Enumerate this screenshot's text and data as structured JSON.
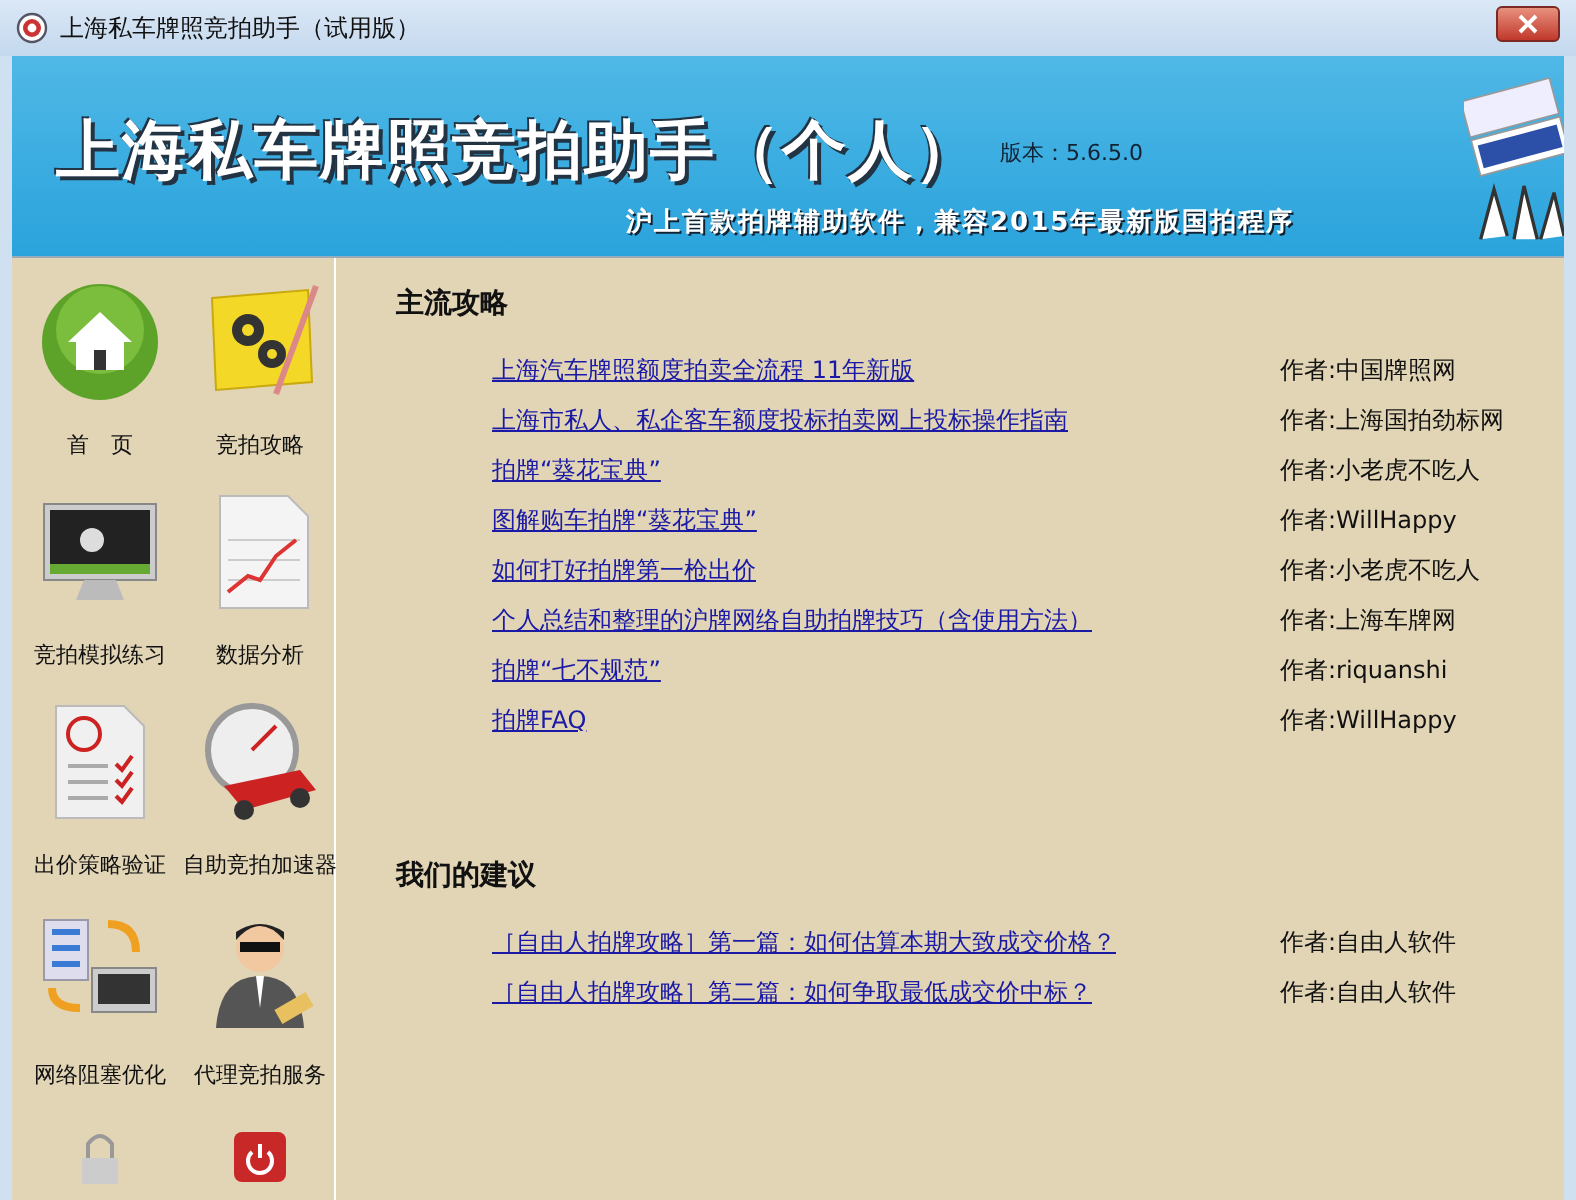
{
  "window": {
    "title": "上海私车牌照竞拍助手（试用版）"
  },
  "banner": {
    "title": "上海私车牌照竞拍助手（个人）",
    "version": "版本：5.6.5.0",
    "slogan": "沪上首款拍牌辅助软件，兼容2015年最新版国拍程序"
  },
  "sidebar": {
    "items": [
      {
        "kind": "home",
        "label": "首　页"
      },
      {
        "kind": "gears",
        "label": "竞拍攻略"
      },
      {
        "kind": "monitor",
        "label": "竞拍模拟练习"
      },
      {
        "kind": "chart",
        "label": "数据分析"
      },
      {
        "kind": "checklist",
        "label": "出价策略验证"
      },
      {
        "kind": "gauge",
        "label": "自助竞拍加速器"
      },
      {
        "kind": "network",
        "label": "网络阻塞优化"
      },
      {
        "kind": "agent",
        "label": "代理竞拍服务"
      },
      {
        "kind": "lock"
      },
      {
        "kind": "power"
      }
    ]
  },
  "sections": [
    {
      "heading": "主流攻略",
      "articles": [
        {
          "title": "上海汽车牌照额度拍卖全流程 11年新版",
          "author": "作者:中国牌照网"
        },
        {
          "title": "上海市私人、私企客车额度投标拍卖网上投标操作指南",
          "author": "作者:上海国拍劲标网"
        },
        {
          "title": "拍牌“葵花宝典”",
          "author": "作者:小老虎不吃人"
        },
        {
          "title": "图解购车拍牌“葵花宝典”",
          "author": "作者:WillHappy"
        },
        {
          "title": "如何打好拍牌第一枪出价",
          "author": "作者:小老虎不吃人"
        },
        {
          "title": "个人总结和整理的沪牌网络自助拍牌技巧（含使用方法）",
          "author": "作者:上海车牌网"
        },
        {
          "title": "拍牌“七不规范”",
          "author": "作者:riquanshi"
        },
        {
          "title": "拍牌FAQ",
          "author": "作者:WillHappy"
        }
      ]
    },
    {
      "heading": "我们的建议",
      "articles": [
        {
          "title": "［自由人拍牌攻略］第一篇：如何估算本期大致成交价格？",
          "author": "作者:自由人软件"
        },
        {
          "title": "［自由人拍牌攻略］第二篇：如何争取最低成交价中标？",
          "author": "作者:自由人软件"
        }
      ]
    }
  ]
}
